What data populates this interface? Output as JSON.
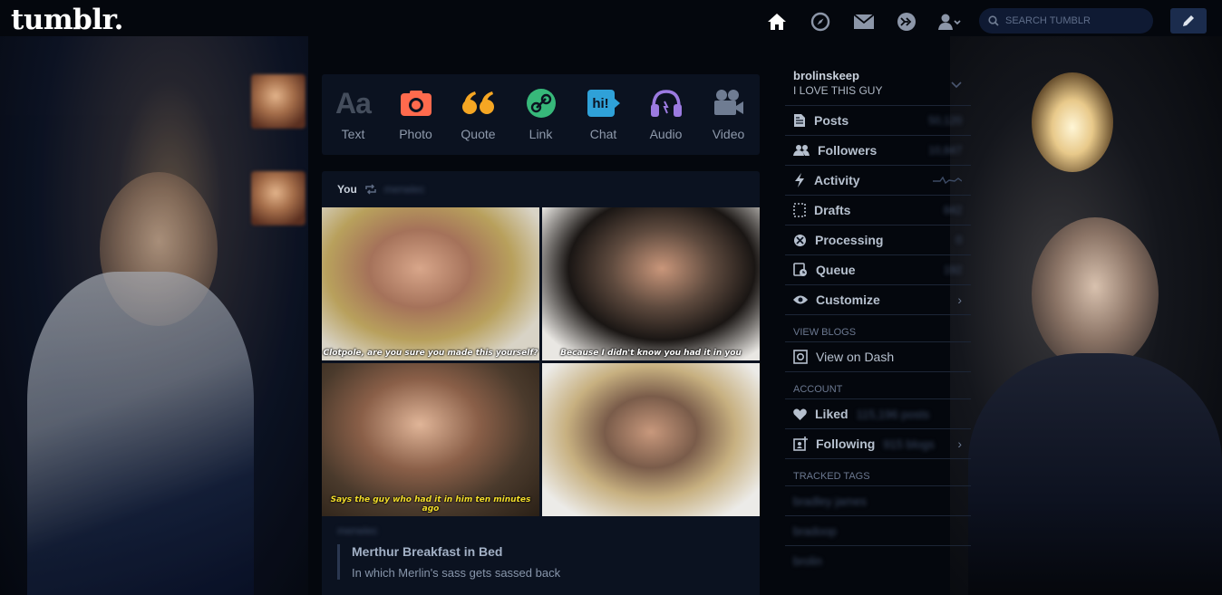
{
  "header": {
    "logo": "tumblr.",
    "nav_icons": [
      "home-icon",
      "explore-icon",
      "inbox-icon",
      "activity-icon",
      "account-icon"
    ],
    "search_placeholder": "SEARCH TUMBLR",
    "compose_icon": "pencil-icon"
  },
  "post_types": [
    {
      "label": "Text",
      "glyph": "Aa",
      "color": "#444d5c"
    },
    {
      "label": "Photo",
      "color": "#ff6a4d"
    },
    {
      "label": "Quote",
      "glyph": "“",
      "color": "#f5a623"
    },
    {
      "label": "Link",
      "color": "#37b87a"
    },
    {
      "label": "Chat",
      "glyph": "hi!",
      "color": "#2fa1d8"
    },
    {
      "label": "Audio",
      "color": "#9b7ae0"
    },
    {
      "label": "Video",
      "color": "#6f7c92"
    }
  ],
  "post": {
    "reblogged_by": "You",
    "source_blog": "merwiec",
    "captions": [
      "Clotpole, are you sure you made this yourself?",
      "Because I didn't know you had it in you",
      "Says the guy who had it in him ten minutes ago",
      ""
    ],
    "body_blog": "merwiec",
    "title": "Merthur Breakfast in Bed",
    "description": "In which Merlin's sass gets sassed back"
  },
  "sidebar": {
    "blog_name": "brolinskeep",
    "blog_title": "I LOVE THIS GUY",
    "items": [
      {
        "label": "Posts",
        "count": "50,120"
      },
      {
        "label": "Followers",
        "count": "10,847"
      },
      {
        "label": "Activity",
        "count": ""
      },
      {
        "label": "Drafts",
        "count": "842"
      },
      {
        "label": "Processing",
        "count": "0"
      },
      {
        "label": "Queue",
        "count": "192"
      },
      {
        "label": "Customize",
        "count": ""
      }
    ],
    "view_blogs_label": "VIEW BLOGS",
    "view_on_dash": "View on Dash",
    "account_label": "ACCOUNT",
    "liked_label": "Liked",
    "liked_count": "115,196 posts",
    "following_label": "Following",
    "following_count": "915 blogs",
    "tracked_tags_label": "TRACKED TAGS",
    "tags": [
      "bradley james",
      "bradoop",
      "brolin"
    ]
  }
}
